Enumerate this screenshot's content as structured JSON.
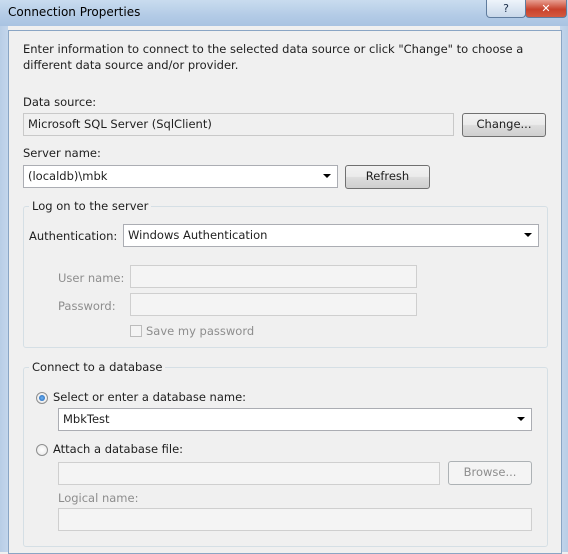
{
  "window": {
    "title": "Connection Properties",
    "help_glyph": "?",
    "close_glyph": "✕"
  },
  "intro": "Enter information to connect to the selected data source or click \"Change\" to choose a different data source and/or provider.",
  "data_source": {
    "label": "Data source:",
    "value": "Microsoft SQL Server (SqlClient)",
    "change_button": "Change..."
  },
  "server": {
    "label": "Server name:",
    "value": "(localdb)\\mbk",
    "refresh_button": "Refresh"
  },
  "logon": {
    "group_title": "Log on to the server",
    "auth_label": "Authentication:",
    "auth_value": "Windows Authentication",
    "username_label": "User name:",
    "password_label": "Password:",
    "save_password_label": "Save my password"
  },
  "database": {
    "group_title": "Connect to a database",
    "select_label": "Select or enter a database name:",
    "select_value": "MbkTest",
    "attach_label": "Attach a database file:",
    "browse_button": "Browse...",
    "logical_name_label": "Logical name:"
  }
}
